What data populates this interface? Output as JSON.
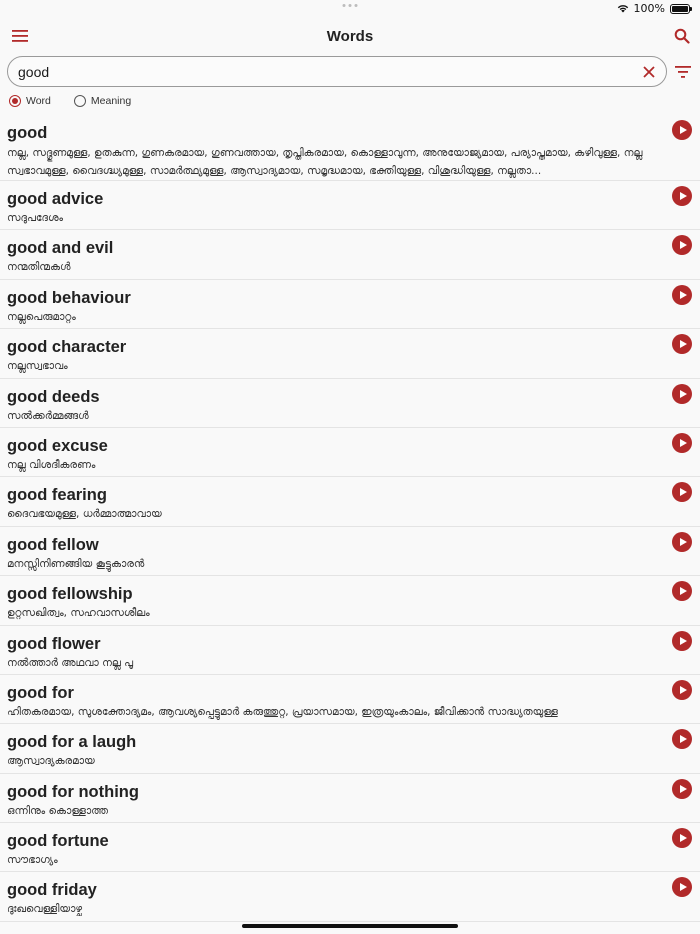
{
  "status": {
    "battery_text": "100%",
    "battery_level": 1.0
  },
  "nav": {
    "title": "Words"
  },
  "search": {
    "value": "good",
    "placeholder": ""
  },
  "search_mode": {
    "options": [
      "Word",
      "Meaning"
    ],
    "selected": "Word"
  },
  "colors": {
    "accent": "#b12a2a",
    "background": "#f9f9f9"
  },
  "icons": [
    "hamburger-menu-icon",
    "search-icon",
    "clear-x-icon",
    "filter-icon",
    "play-icon",
    "wifi-icon",
    "battery-icon"
  ],
  "results": [
    {
      "word": "good",
      "meaning": "നല്ല, സദ്ഗുണമുള്ള, ഉതകുന്ന, ഗുണകരമായ, ഗുണവത്തായ, തൃപ്തികരമായ, കൊള്ളാവുന്ന, അനുയോജ്യമായ, പര്യാപ്തമായ, കഴിവുള്ള, നല്ല സ്വഭാവമുള്ള, വൈദഗ്ദ്ധ്യമുള്ള, സാമർത്ഥ്യമുള്ള, ആസ്വാദ്യമായ, സമൃദ്ധമായ, ഭക്തിയുള്ള, വിശുദ്ധിയുള്ള, നല്ലതാ..."
    },
    {
      "word": "good advice",
      "meaning": "സദുപദേശം"
    },
    {
      "word": "good and evil",
      "meaning": "നന്മതിന്മകൾ"
    },
    {
      "word": "good behaviour",
      "meaning": "നല്ലപെരുമാറ്റം"
    },
    {
      "word": "good character",
      "meaning": "നല്ലസ്വഭാവം"
    },
    {
      "word": "good deeds",
      "meaning": "സൽക്കർമ്മങ്ങൾ"
    },
    {
      "word": "good excuse",
      "meaning": "നല്ല വിശദീകരണം"
    },
    {
      "word": "good fearing",
      "meaning": "ദൈവഭയമുള്ള, ധർമ്മാത്മാവായ"
    },
    {
      "word": "good fellow",
      "meaning": "മനസ്സിനിണങ്ങിയ കൂട്ടുകാരൻ"
    },
    {
      "word": "good fellowship",
      "meaning": "ഉറ്റസഖിത്വം, സഹവാസശീലം"
    },
    {
      "word": "good flower",
      "meaning": "നൽത്താർ അഥവാ നല്ല പൂ"
    },
    {
      "word": "good for",
      "meaning": "ഹിതകരമായ, സുശക്തോദ്യമം, ആവശ്യപ്പെട്ടുമാർ കരുത്തുറ്റ, പ്രയാസമായ, ഇത്രയുംകാലം, ജീവിക്കാൻ സാദ്ധ്യതയുള്ള"
    },
    {
      "word": "good for a laugh",
      "meaning": "ആസ്വാദ്യകരമായ"
    },
    {
      "word": "good for nothing",
      "meaning": "ഒന്നിനും കൊള്ളാത്ത"
    },
    {
      "word": "good fortune",
      "meaning": "സൗഭാഗ്യം"
    },
    {
      "word": "good friday",
      "meaning": "ദുഃഖവെള്ളിയാഴ്ച"
    }
  ]
}
